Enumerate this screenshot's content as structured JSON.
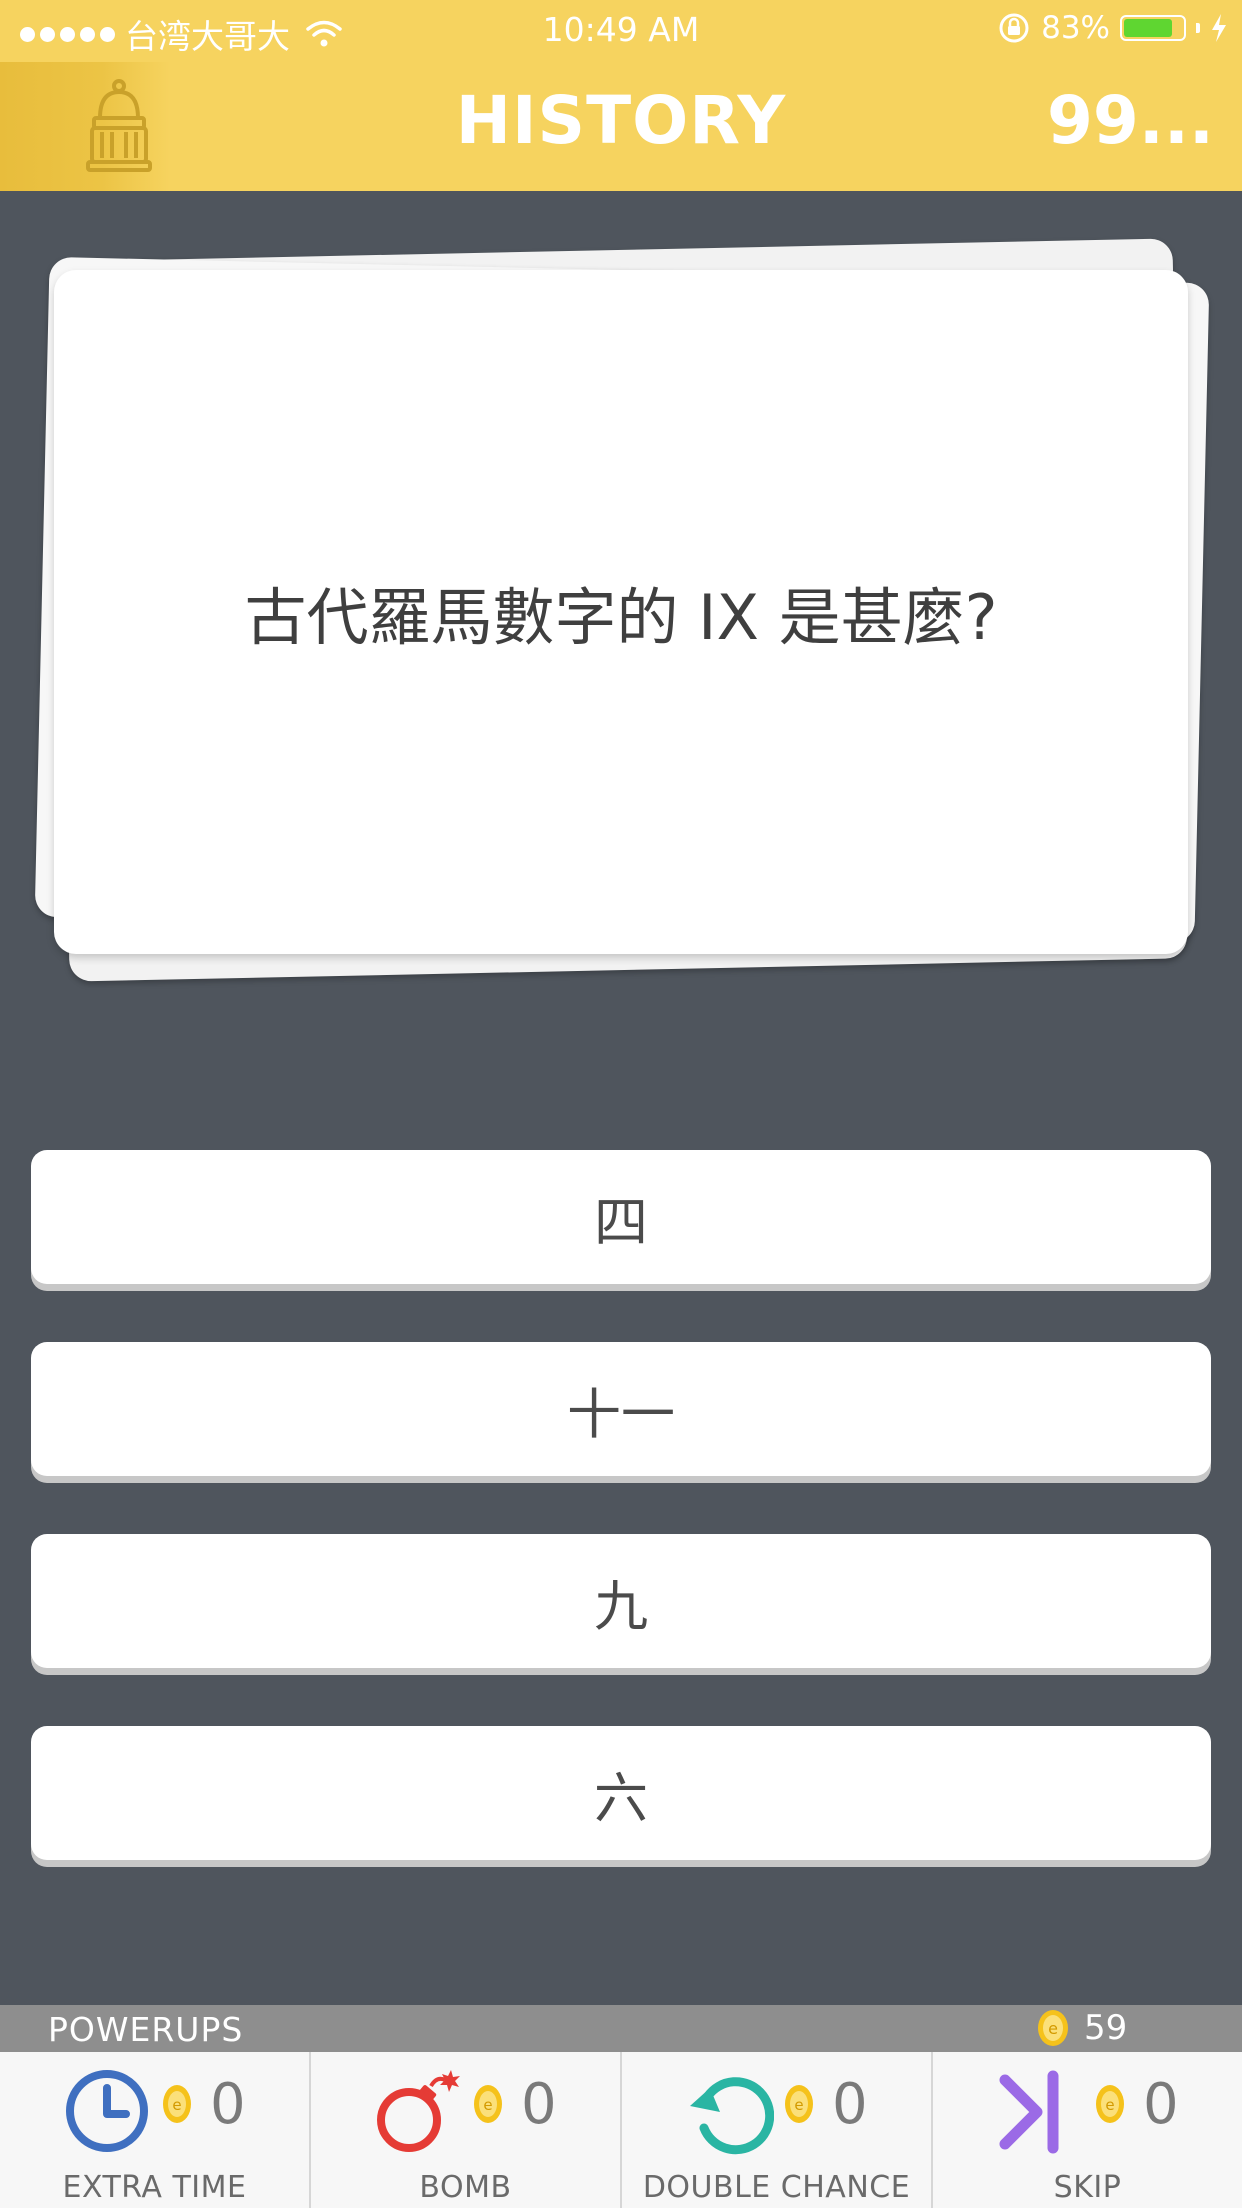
{
  "status_bar": {
    "carrier": "台湾大哥大",
    "time": "10:49 AM",
    "battery_percent": "83%",
    "battery_level": 0.83,
    "battery_color": "#5fd631"
  },
  "header": {
    "category": "HISTORY",
    "score": "99...",
    "background_color": "#f6d35f",
    "icon": "crown-icon"
  },
  "question": {
    "text": "古代羅馬數字的 IX 是甚麼?"
  },
  "answers": [
    {
      "label": "四"
    },
    {
      "label": "十一"
    },
    {
      "label": "九"
    },
    {
      "label": "六"
    }
  ],
  "powerups": {
    "section_label": "POWERUPS",
    "coins_total": "59",
    "items": [
      {
        "label": "EXTRA TIME",
        "count": "0",
        "icon": "clock-icon",
        "color": "#3f6fc0"
      },
      {
        "label": "BOMB",
        "count": "0",
        "icon": "bomb-icon",
        "color": "#e53b35"
      },
      {
        "label": "DOUBLE CHANCE",
        "count": "0",
        "icon": "refresh-icon",
        "color": "#2ab5a3"
      },
      {
        "label": "SKIP",
        "count": "0",
        "icon": "skip-icon",
        "color": "#9b6ae6"
      }
    ]
  }
}
